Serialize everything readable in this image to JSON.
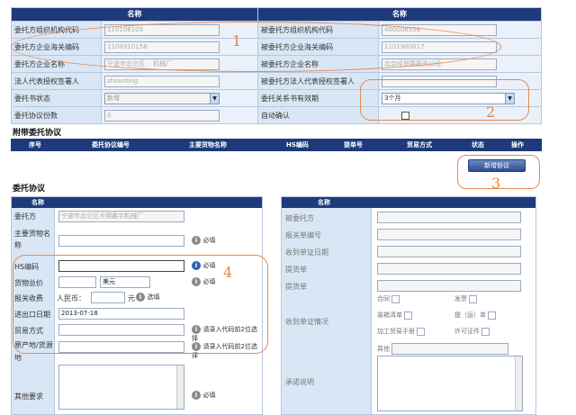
{
  "top": {
    "col_header_left": "名称",
    "col_header_right": "名称",
    "rows": [
      {
        "l_label": "委托方组织机构代码",
        "l_value": "110108105",
        "r_label": "被委托方组织机构代码",
        "r_value": "400008538"
      },
      {
        "l_label": "委托方企业海关编码",
        "l_value": "1100910158",
        "r_label": "被委托方企业海关编码",
        "r_value": "1101900017"
      },
      {
        "l_label": "委托方企业名称",
        "l_value": "宁波市北仑区",
        "l_value2": "机械厂",
        "r_label": "被委托方企业名称",
        "r_value": "北京经贸委报关公司"
      },
      {
        "l_label": "法人代表授权签署人",
        "l_value": "zhouming",
        "r_label": "被委托方法人代表授权签署人",
        "r_value": ""
      },
      {
        "l_label": "委托书状态",
        "l_value": "新增",
        "r_label": "委托关系书有效期",
        "r_value": "3个月"
      },
      {
        "l_label": "委托协议份数",
        "l_value": "0",
        "r_label": "自动确认",
        "r_value": ""
      }
    ]
  },
  "attached": {
    "title": "附带委托协议",
    "columns": [
      "序号",
      "委托协议编号",
      "主要货物名称",
      "HS编码",
      "提单号",
      "贸易方式",
      "状态",
      "操作"
    ],
    "add_button": "新增协议"
  },
  "agreement": {
    "title": "委托协议",
    "left_header": "名称",
    "right_header": "名称",
    "consignor_label": "委托方",
    "consignor_value": "宁波市北仑区大碶鑫宇机械厂",
    "goods_label": "主要货物名称",
    "hs_label": "HS编码",
    "total_label": "货物总价",
    "currency": "美元",
    "fee_label": "报关收费",
    "rmb_label": "人民币：",
    "yuan_label": "元",
    "date_label": "进出口日期",
    "date_value": "2013-07-18",
    "trade_label": "贸易方式",
    "origin_label": "原产地/货源地",
    "other_label": "其他要求",
    "required": "必填",
    "optional": "选填",
    "hint_code": "请录入代码前2位选择",
    "right_labels": [
      "被委托方",
      "报关单编号",
      "收到单证日期",
      "提货单",
      "提货单",
      "收到单证情况",
      "承诺说明"
    ],
    "docs": [
      "合同",
      "发票",
      "装箱清单",
      "提（运）单",
      "加工贸易手册",
      "许可证件",
      "其他"
    ]
  },
  "annotations": {
    "one": "1",
    "two": "2",
    "three": "3",
    "four": "4"
  }
}
